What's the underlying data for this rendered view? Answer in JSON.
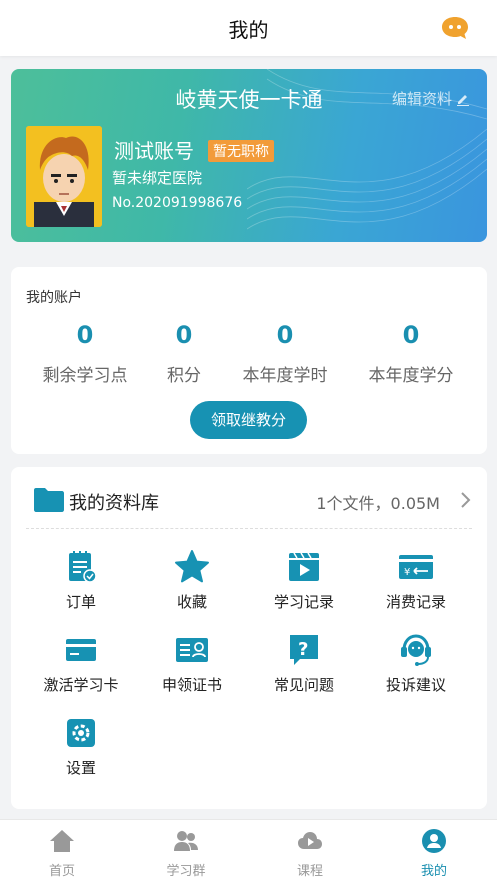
{
  "header": {
    "title": "我的"
  },
  "profile": {
    "card_title": "岐黄天使一卡通",
    "edit_label": "编辑资料",
    "account_name": "测试账号",
    "rank": "暂无职称",
    "hospital": "暂未绑定医院",
    "account_no": "No.202091998676"
  },
  "account": {
    "label": "我的账户",
    "stats": [
      {
        "value": "0",
        "name": "剩余学习点"
      },
      {
        "value": "0",
        "name": "积分"
      },
      {
        "value": "0",
        "name": "本年度学时"
      },
      {
        "value": "0",
        "name": "本年度学分"
      }
    ],
    "claim_button": "领取继教分"
  },
  "library": {
    "title": "我的资料库",
    "info": "1个文件，0.05M",
    "items": [
      {
        "label": "订单",
        "icon": "order-icon"
      },
      {
        "label": "收藏",
        "icon": "star-icon"
      },
      {
        "label": "学习记录",
        "icon": "video-record-icon"
      },
      {
        "label": "消费记录",
        "icon": "payment-record-icon"
      },
      {
        "label": "激活学习卡",
        "icon": "card-icon"
      },
      {
        "label": "申领证书",
        "icon": "certificate-icon"
      },
      {
        "label": "常见问题",
        "icon": "question-icon"
      },
      {
        "label": "投诉建议",
        "icon": "headset-icon"
      },
      {
        "label": "设置",
        "icon": "gear-icon"
      }
    ]
  },
  "tabs": [
    {
      "label": "首页",
      "icon": "home-icon"
    },
    {
      "label": "学习群",
      "icon": "group-icon"
    },
    {
      "label": "课程",
      "icon": "cloud-play-icon"
    },
    {
      "label": "我的",
      "icon": "user-icon"
    }
  ],
  "colors": {
    "accent": "#1a8fb0",
    "badge": "#f29b3a",
    "message": "#f0a22e",
    "tab_inactive": "#999999"
  }
}
